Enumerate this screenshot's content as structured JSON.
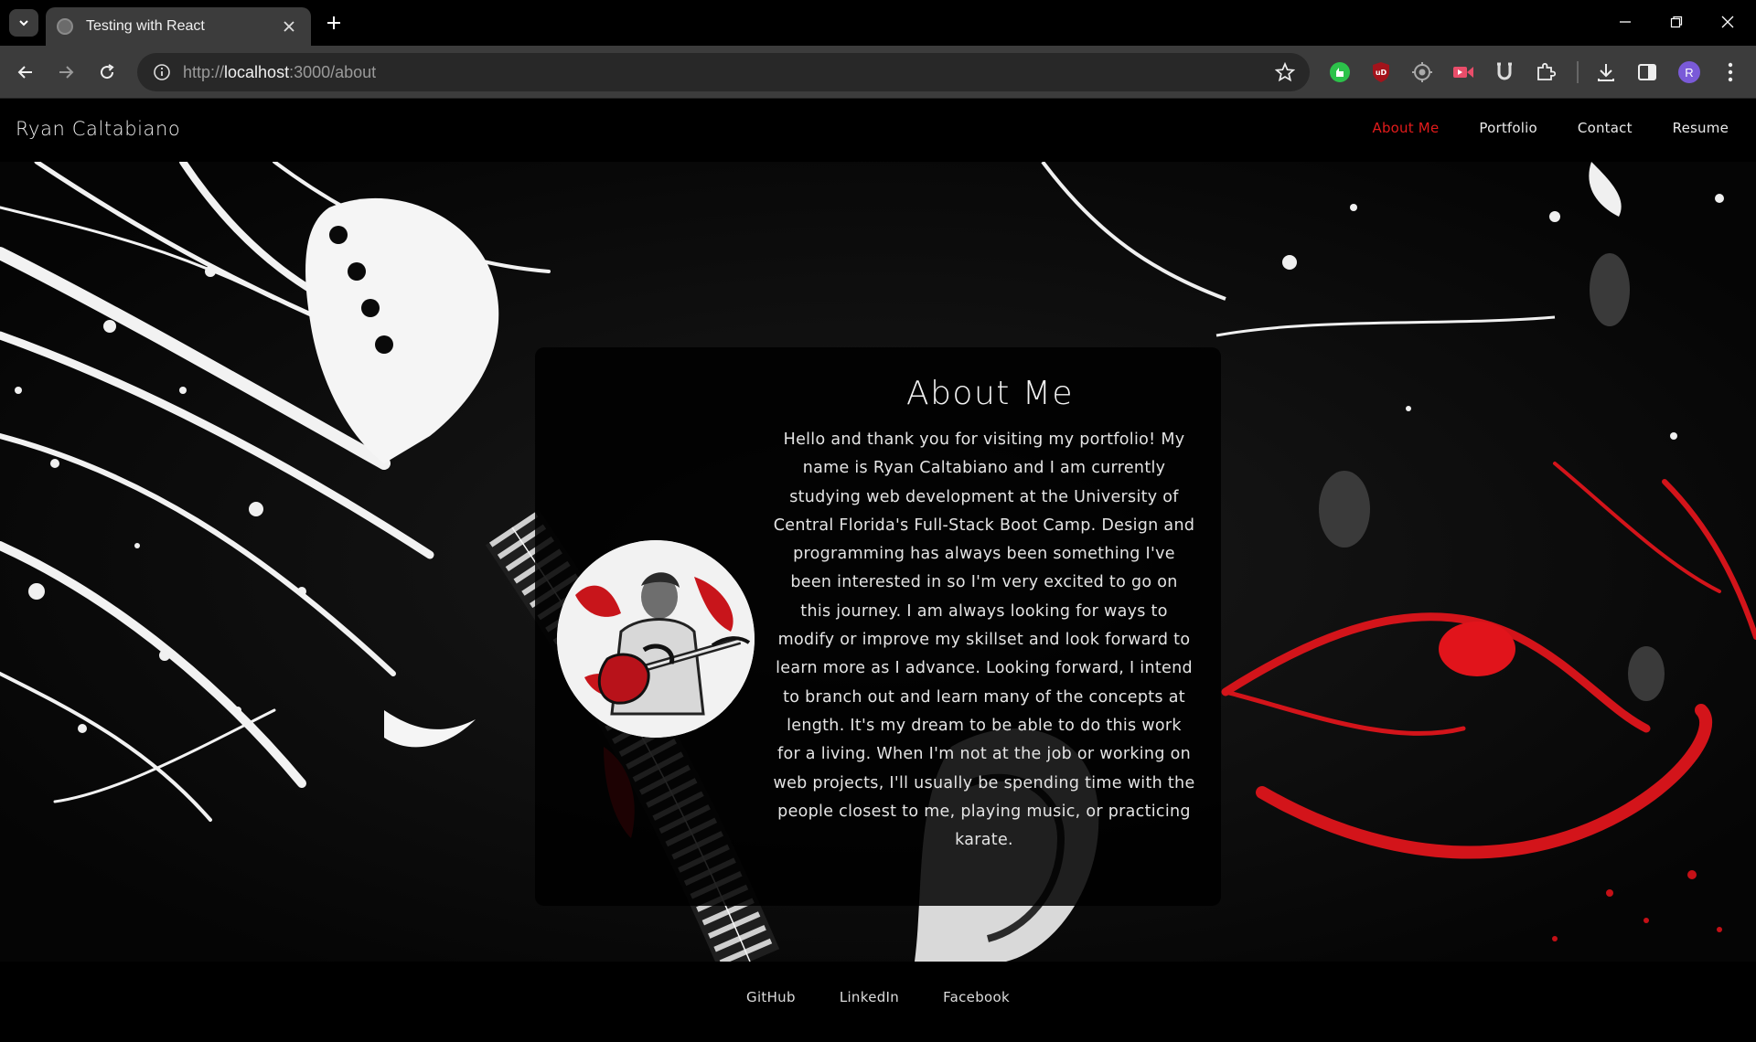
{
  "browser": {
    "tab_title": "Testing with React",
    "url_scheme": "http://",
    "url_host": "localhost",
    "url_rest": ":3000/about",
    "profile_initial": "R"
  },
  "site": {
    "brand": "Ryan Caltabiano",
    "nav": [
      {
        "label": "About Me",
        "active": true
      },
      {
        "label": "Portfolio",
        "active": false
      },
      {
        "label": "Contact",
        "active": false
      },
      {
        "label": "Resume",
        "active": false
      }
    ],
    "accent": "#e21b1b"
  },
  "about": {
    "title": "About Me",
    "paragraph": "Hello and thank you for visiting my portfolio! My name is Ryan Caltabiano and I am currently studying web development at the University of Central Florida's Full-Stack Boot Camp. Design and programming has always been something I've been interested in so I'm very excited to go on this journey. I am always looking for ways to modify or improve my skillset and look forward to learn more as I advance. Looking forward, I intend to branch out and learn many of the concepts at length. It's my dream to be able to do this work for a living. When I'm not at the job or working on web projects, I'll usually be spending time with the people closest to me, playing music, or practicing karate."
  },
  "footer": {
    "links": [
      "GitHub",
      "LinkedIn",
      "Facebook"
    ]
  }
}
